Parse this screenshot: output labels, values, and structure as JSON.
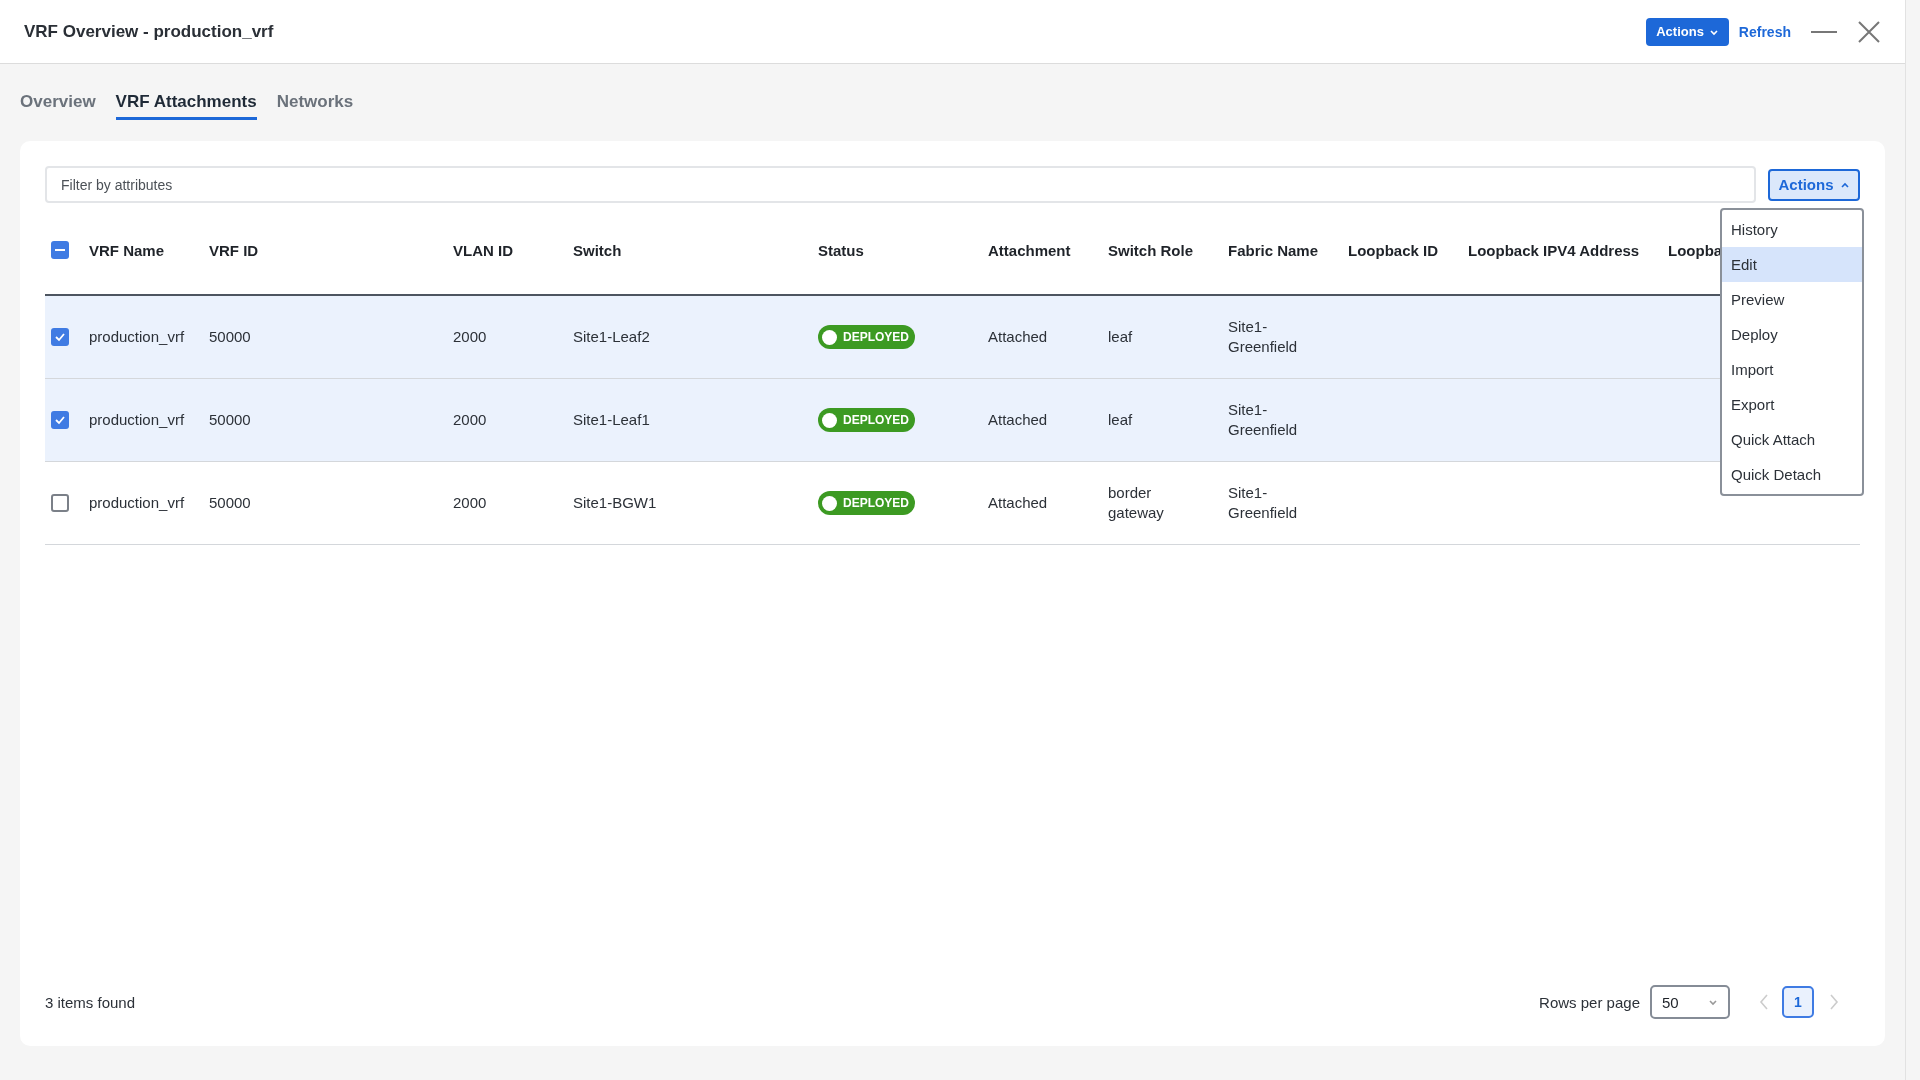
{
  "window": {
    "title": "VRF Overview - production_vrf",
    "actions_button": "Actions",
    "refresh_link": "Refresh"
  },
  "tabs": [
    {
      "label": "Overview",
      "selected": false
    },
    {
      "label": "VRF Attachments",
      "selected": true
    },
    {
      "label": "Networks",
      "selected": false
    }
  ],
  "filter": {
    "placeholder": "Filter by attributes"
  },
  "actions_menu": {
    "label": "Actions",
    "expanded": true,
    "items": [
      {
        "label": "History",
        "selected": false
      },
      {
        "label": "Edit",
        "selected": true
      },
      {
        "label": "Preview",
        "selected": false
      },
      {
        "label": "Deploy",
        "selected": false
      },
      {
        "label": "Import",
        "selected": false
      },
      {
        "label": "Export",
        "selected": false
      },
      {
        "label": "Quick Attach",
        "selected": false
      },
      {
        "label": "Quick Detach",
        "selected": false
      }
    ]
  },
  "table": {
    "select_all_indeterminate": true,
    "columns": [
      "VRF Name",
      "VRF ID",
      "VLAN ID",
      "Switch",
      "Status",
      "Attachment",
      "Switch Role",
      "Fabric Name",
      "Loopback ID",
      "Loopback IPV4 Address",
      "Loopba"
    ],
    "rows": [
      {
        "selected": true,
        "cells": [
          "production_vrf",
          "50000",
          "2000",
          "Site1-Leaf2",
          "DEPLOYED",
          "Attached",
          "leaf",
          "Site1-\nGreenfield"
        ]
      },
      {
        "selected": true,
        "cells": [
          "production_vrf",
          "50000",
          "2000",
          "Site1-Leaf1",
          "DEPLOYED",
          "Attached",
          "leaf",
          "Site1-\nGreenfield"
        ]
      },
      {
        "selected": false,
        "cells": [
          "production_vrf",
          "50000",
          "2000",
          "Site1-BGW1",
          "DEPLOYED",
          "Attached",
          "border\ngateway",
          "Site1-\nGreenfield"
        ]
      }
    ]
  },
  "footer": {
    "count": "3 items found",
    "rows_per_page_label": "Rows per page",
    "rows_per_page": "50",
    "pages": [
      {
        "label": "1",
        "selected": true
      }
    ]
  }
}
